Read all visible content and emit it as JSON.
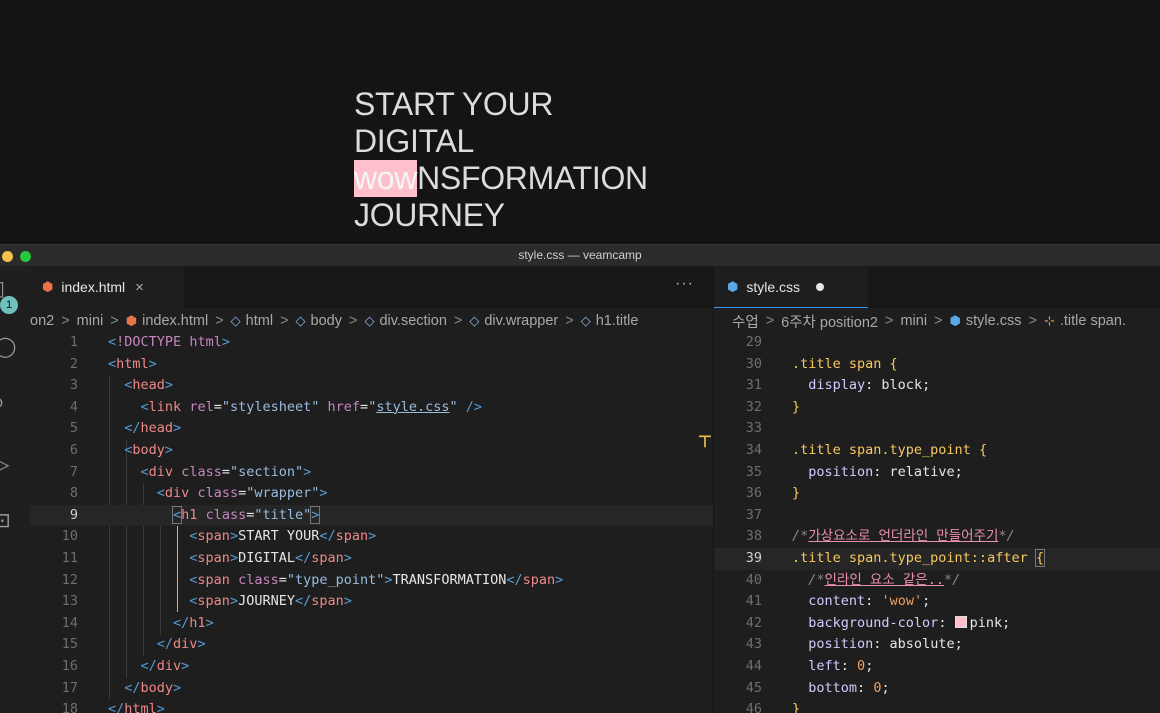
{
  "preview": {
    "lines": [
      "START YOUR",
      "DIGITAL",
      "TRANSFORMATION",
      "JOURNEY"
    ],
    "after_content": "wow",
    "after_bg": "pink"
  },
  "window": {
    "title": "style.css — veamcamp",
    "badge": "1"
  },
  "left": {
    "tab_label": "index.html",
    "tab_close": "×",
    "more": "···",
    "breadcrumbs": [
      "on2",
      "mini",
      "index.html",
      "html",
      "body",
      "div.section",
      "div.wrapper",
      "h1.title"
    ],
    "line_numbers": [
      "1",
      "2",
      "3",
      "4",
      "5",
      "6",
      "7",
      "8",
      "9",
      "10",
      "11",
      "12",
      "13",
      "14",
      "15",
      "16",
      "17",
      "18"
    ]
  },
  "right": {
    "tab_label": "style.css",
    "breadcrumbs": [
      "수업",
      "6주차 position2",
      "mini",
      "style.css",
      ".title span."
    ],
    "line_numbers": [
      "29",
      "30",
      "31",
      "32",
      "33",
      "34",
      "35",
      "36",
      "37",
      "38",
      "39",
      "40",
      "41",
      "42",
      "43",
      "44",
      "45",
      "46"
    ]
  }
}
